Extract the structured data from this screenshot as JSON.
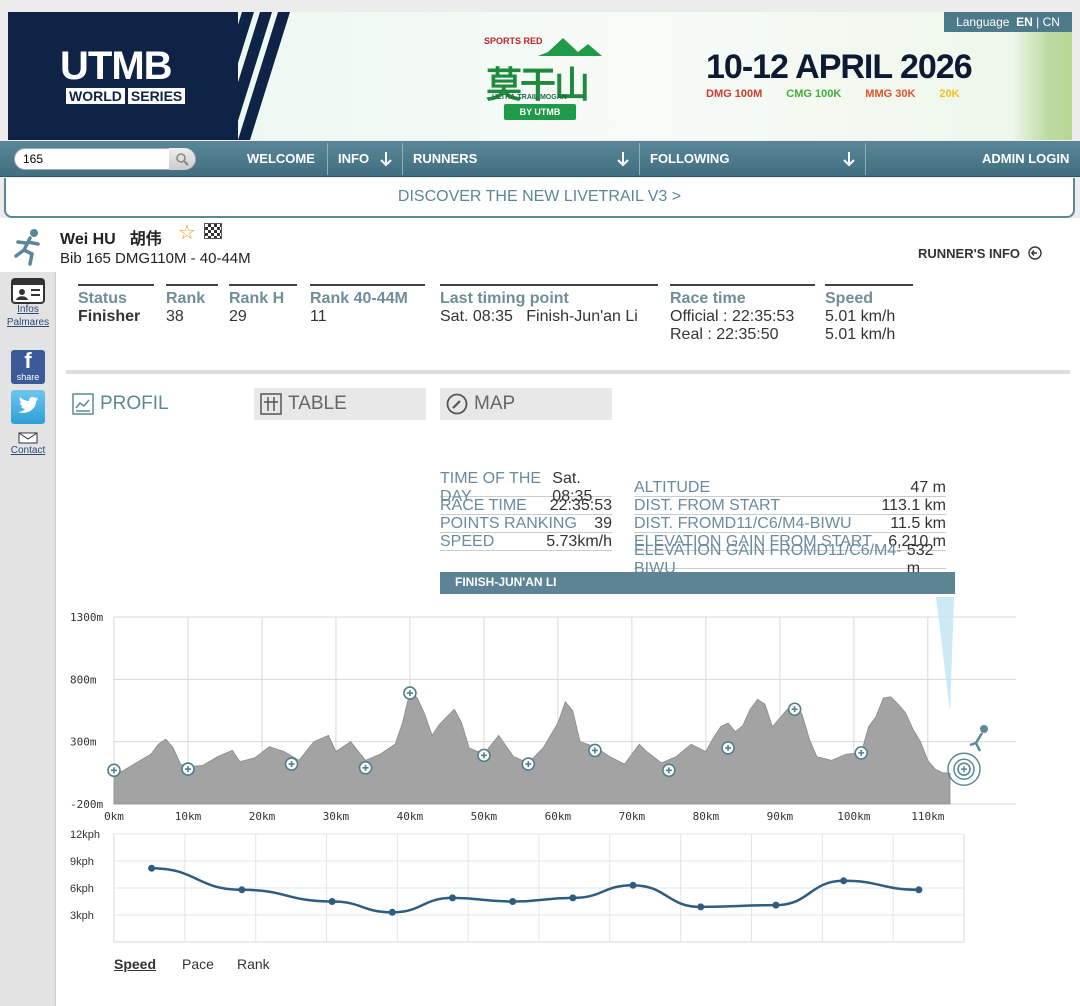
{
  "banner": {
    "brand": "UTMB",
    "brand_sub1": "WORLD",
    "brand_sub2": "SERIES",
    "sponsor": "SPORTS RED",
    "event_zh": "莫干山",
    "event_sub": "ULTRA-TRAIL MOGAN",
    "event_by": "BY UTMB",
    "date": "10-12 APRIL 2026",
    "races": [
      "DMG 100M",
      "CMG 100K",
      "MMG 30K",
      "20K"
    ],
    "language_label": "Language",
    "lang_en": "EN",
    "lang_cn": "CN"
  },
  "nav": {
    "search_value": "165",
    "items": [
      "WELCOME",
      "INFO",
      "RUNNERS",
      "FOLLOWING",
      "ADMIN LOGIN"
    ]
  },
  "livetrail_banner": "DISCOVER THE NEW LIVETRAIL V3 >",
  "runner": {
    "name": "Wei HU",
    "name_zh": "胡伟",
    "bib": "Bib 165   DMG110M - 40-44M",
    "info_button": "RUNNER'S INFO"
  },
  "sidebar": {
    "infos": "Infos",
    "palmares": "Palmares",
    "share": "share",
    "contact": "Contact"
  },
  "stats": {
    "status_label": "Status",
    "status_value": "Finisher",
    "rank_label": "Rank",
    "rank_value": "38",
    "rankh_label": "Rank H",
    "rankh_value": "29",
    "rankcat_label": "Rank 40-44M",
    "rankcat_value": "11",
    "timing_label": "Last timing point",
    "timing_value": "Sat. 08:35   Finish-Jun'an Li",
    "racetime_label": "Race time",
    "racetime_official": "Official : 22:35:53",
    "racetime_real": "Real : 22:35:50",
    "speed_label": "Speed",
    "speed_value1": "5.01 km/h",
    "speed_value2": "5.01 km/h"
  },
  "tabs": {
    "profil": "PROFIL",
    "table": "TABLE",
    "map": "MAP"
  },
  "info_table": {
    "left": [
      {
        "k": "TIME OF THE DAY",
        "v": "Sat. 08:35"
      },
      {
        "k": "RACE TIME",
        "v": "22:35:53"
      },
      {
        "k": "POINTS RANKING",
        "v": "39"
      },
      {
        "k": "SPEED",
        "v": "5.73km/h"
      }
    ],
    "right": [
      {
        "k": "ALTITUDE",
        "v": "47 m"
      },
      {
        "k": "DIST. FROM START",
        "v": "113.1 km"
      },
      {
        "k": "DIST. FROMD11/C6/M4-BIWU",
        "v": "11.5 km"
      },
      {
        "k": "ELEVATION GAIN FROM START",
        "v": "6,210 m"
      },
      {
        "k": "ELEVATION GAIN FROMD11/C6/M4-BIWU",
        "v": "532 m"
      }
    ],
    "finish": "FINISH-JUN'AN LI"
  },
  "chart_data": [
    {
      "type": "area",
      "ylim": [
        -200,
        1300
      ],
      "xlim": [
        0,
        113
      ],
      "y_ticks": [
        "1300m",
        "800m",
        "300m",
        "-200m"
      ],
      "x_ticks": [
        "0km",
        "10km",
        "20km",
        "30km",
        "40km",
        "50km",
        "60km",
        "70km",
        "80km",
        "90km",
        "100km",
        "110km"
      ],
      "color": "#a3a3a3",
      "profile": [
        [
          0,
          80
        ],
        [
          1,
          60
        ],
        [
          3,
          130
        ],
        [
          5,
          200
        ],
        [
          6,
          280
        ],
        [
          7,
          320
        ],
        [
          8,
          250
        ],
        [
          9,
          120
        ],
        [
          10,
          100
        ],
        [
          12,
          110
        ],
        [
          14,
          180
        ],
        [
          16,
          230
        ],
        [
          17,
          140
        ],
        [
          19,
          170
        ],
        [
          21,
          260
        ],
        [
          23,
          220
        ],
        [
          25,
          150
        ],
        [
          27,
          300
        ],
        [
          29,
          350
        ],
        [
          30,
          220
        ],
        [
          32,
          300
        ],
        [
          34,
          150
        ],
        [
          36,
          200
        ],
        [
          38,
          280
        ],
        [
          39,
          450
        ],
        [
          40,
          700
        ],
        [
          41,
          650
        ],
        [
          42,
          520
        ],
        [
          43,
          350
        ],
        [
          44,
          440
        ],
        [
          46,
          560
        ],
        [
          47,
          450
        ],
        [
          48,
          250
        ],
        [
          50,
          200
        ],
        [
          52,
          350
        ],
        [
          54,
          180
        ],
        [
          56,
          130
        ],
        [
          58,
          250
        ],
        [
          60,
          450
        ],
        [
          61,
          620
        ],
        [
          62,
          550
        ],
        [
          63,
          300
        ],
        [
          65,
          260
        ],
        [
          67,
          180
        ],
        [
          69,
          120
        ],
        [
          71,
          280
        ],
        [
          72,
          220
        ],
        [
          74,
          130
        ],
        [
          76,
          180
        ],
        [
          78,
          280
        ],
        [
          80,
          220
        ],
        [
          81,
          330
        ],
        [
          82,
          420
        ],
        [
          83,
          450
        ],
        [
          84,
          380
        ],
        [
          85,
          430
        ],
        [
          86,
          560
        ],
        [
          87,
          640
        ],
        [
          88,
          600
        ],
        [
          89,
          420
        ],
        [
          91,
          560
        ],
        [
          92,
          590
        ],
        [
          93,
          520
        ],
        [
          94,
          320
        ],
        [
          95,
          180
        ],
        [
          97,
          150
        ],
        [
          99,
          200
        ],
        [
          101,
          210
        ],
        [
          102,
          420
        ],
        [
          103,
          500
        ],
        [
          104,
          650
        ],
        [
          105,
          660
        ],
        [
          106,
          600
        ],
        [
          107,
          530
        ],
        [
          108,
          400
        ],
        [
          109,
          300
        ],
        [
          110,
          150
        ],
        [
          111,
          80
        ],
        [
          112,
          50
        ],
        [
          113,
          47
        ]
      ],
      "checkpoints": [
        [
          0,
          70
        ],
        [
          10,
          80
        ],
        [
          24,
          120
        ],
        [
          34,
          90
        ],
        [
          40,
          690
        ],
        [
          50,
          190
        ],
        [
          56,
          120
        ],
        [
          65,
          230
        ],
        [
          75,
          70
        ],
        [
          83,
          250
        ],
        [
          92,
          560
        ],
        [
          101,
          210
        ]
      ],
      "finish_marker": 113
    },
    {
      "type": "line",
      "ylim": [
        0,
        12
      ],
      "y_ticks": [
        "12kph",
        "9kph",
        "6kph",
        "3kph"
      ],
      "series": [
        {
          "values": [
            [
              5,
              8.2
            ],
            [
              17,
              5.8
            ],
            [
              29,
              4.5
            ],
            [
              37,
              3.3
            ],
            [
              45,
              4.9
            ],
            [
              53,
              4.5
            ],
            [
              61,
              4.9
            ],
            [
              69,
              6.3
            ],
            [
              78,
              3.9
            ],
            [
              88,
              4.1
            ],
            [
              97,
              6.8
            ],
            [
              107,
              5.8
            ]
          ]
        }
      ],
      "xlim": [
        0,
        113
      ],
      "color": "#2d5d80",
      "tabs": [
        "Speed",
        "Pace",
        "Rank"
      ],
      "active_tab": "Speed"
    }
  ]
}
